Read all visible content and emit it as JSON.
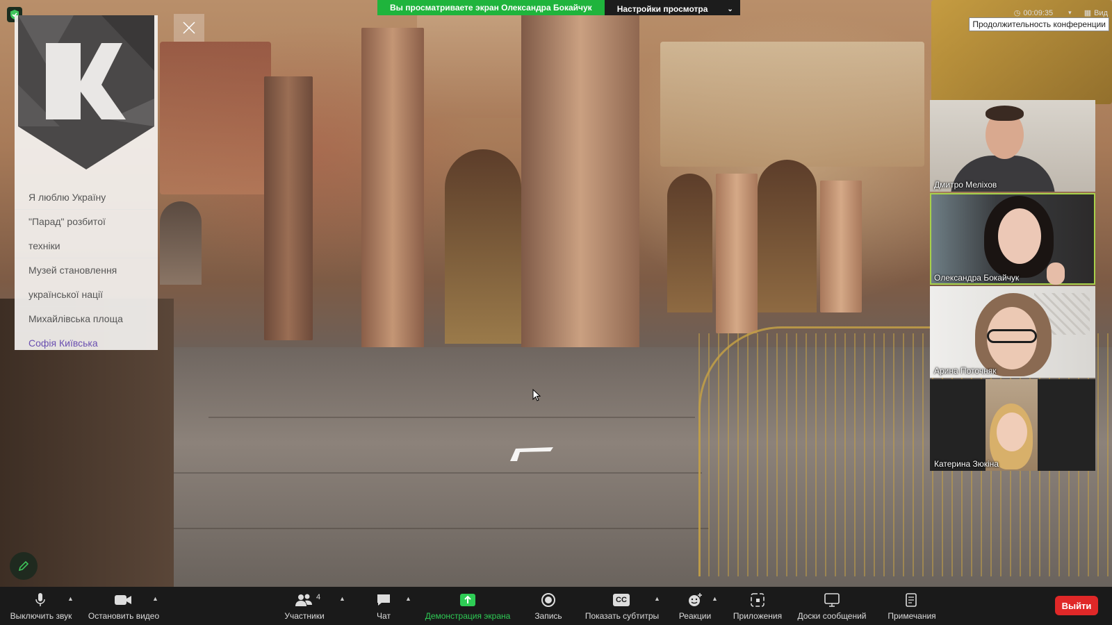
{
  "banner": {
    "viewing_notice": "Вы просматриваете экран Олександра Бокайчук",
    "view_settings": "Настройки просмотра"
  },
  "meeting": {
    "timer": "00:09:35",
    "view_label": "Вид",
    "duration_tooltip": "Продолжительность конференции"
  },
  "site_menu": {
    "items": [
      {
        "label": "Я люблю Україну",
        "active": false
      },
      {
        "label_line1": "\"Парад\" розбитої",
        "label_line2": "техніки",
        "active": false
      },
      {
        "label_line1": "Музей становлення",
        "label_line2": "української нації",
        "active": false
      },
      {
        "label": "Михайлівська площа",
        "active": false
      },
      {
        "label": "Софія Київська",
        "active": true
      }
    ]
  },
  "participants": [
    {
      "name": "Дмитро Меліхов",
      "active": false
    },
    {
      "name": "Олександра Бокайчук",
      "active": true
    },
    {
      "name": "Арина Поточняк",
      "active": false
    },
    {
      "name": "Катерина Зюкіна",
      "active": false
    }
  ],
  "toolbar": {
    "mute": "Выключить звук",
    "stop_video": "Остановить видео",
    "participants": "Участники",
    "participants_count": "4",
    "chat": "Чат",
    "share_screen": "Демонстрация экрана",
    "record": "Запись",
    "captions": "Показать субтитры",
    "captions_icon": "CC",
    "reactions": "Реакции",
    "apps": "Приложения",
    "whiteboards": "Доски сообщений",
    "notes": "Примечания",
    "leave": "Выйти"
  },
  "colors": {
    "share_green": "#2ecc55",
    "banner_green": "#1fb43c",
    "leave_red": "#e02828",
    "active_menu": "#6a4fb0",
    "active_speaker": "#a7d14a"
  },
  "icons": [
    "shield-icon",
    "close-icon",
    "pencil-icon",
    "mic-icon",
    "camera-icon",
    "people-icon",
    "chat-icon",
    "share-screen-icon",
    "record-icon",
    "captions-icon",
    "reactions-icon",
    "apps-icon",
    "whiteboard-icon",
    "notes-icon",
    "chevron-up-icon",
    "chevron-down-icon",
    "clock-icon"
  ]
}
